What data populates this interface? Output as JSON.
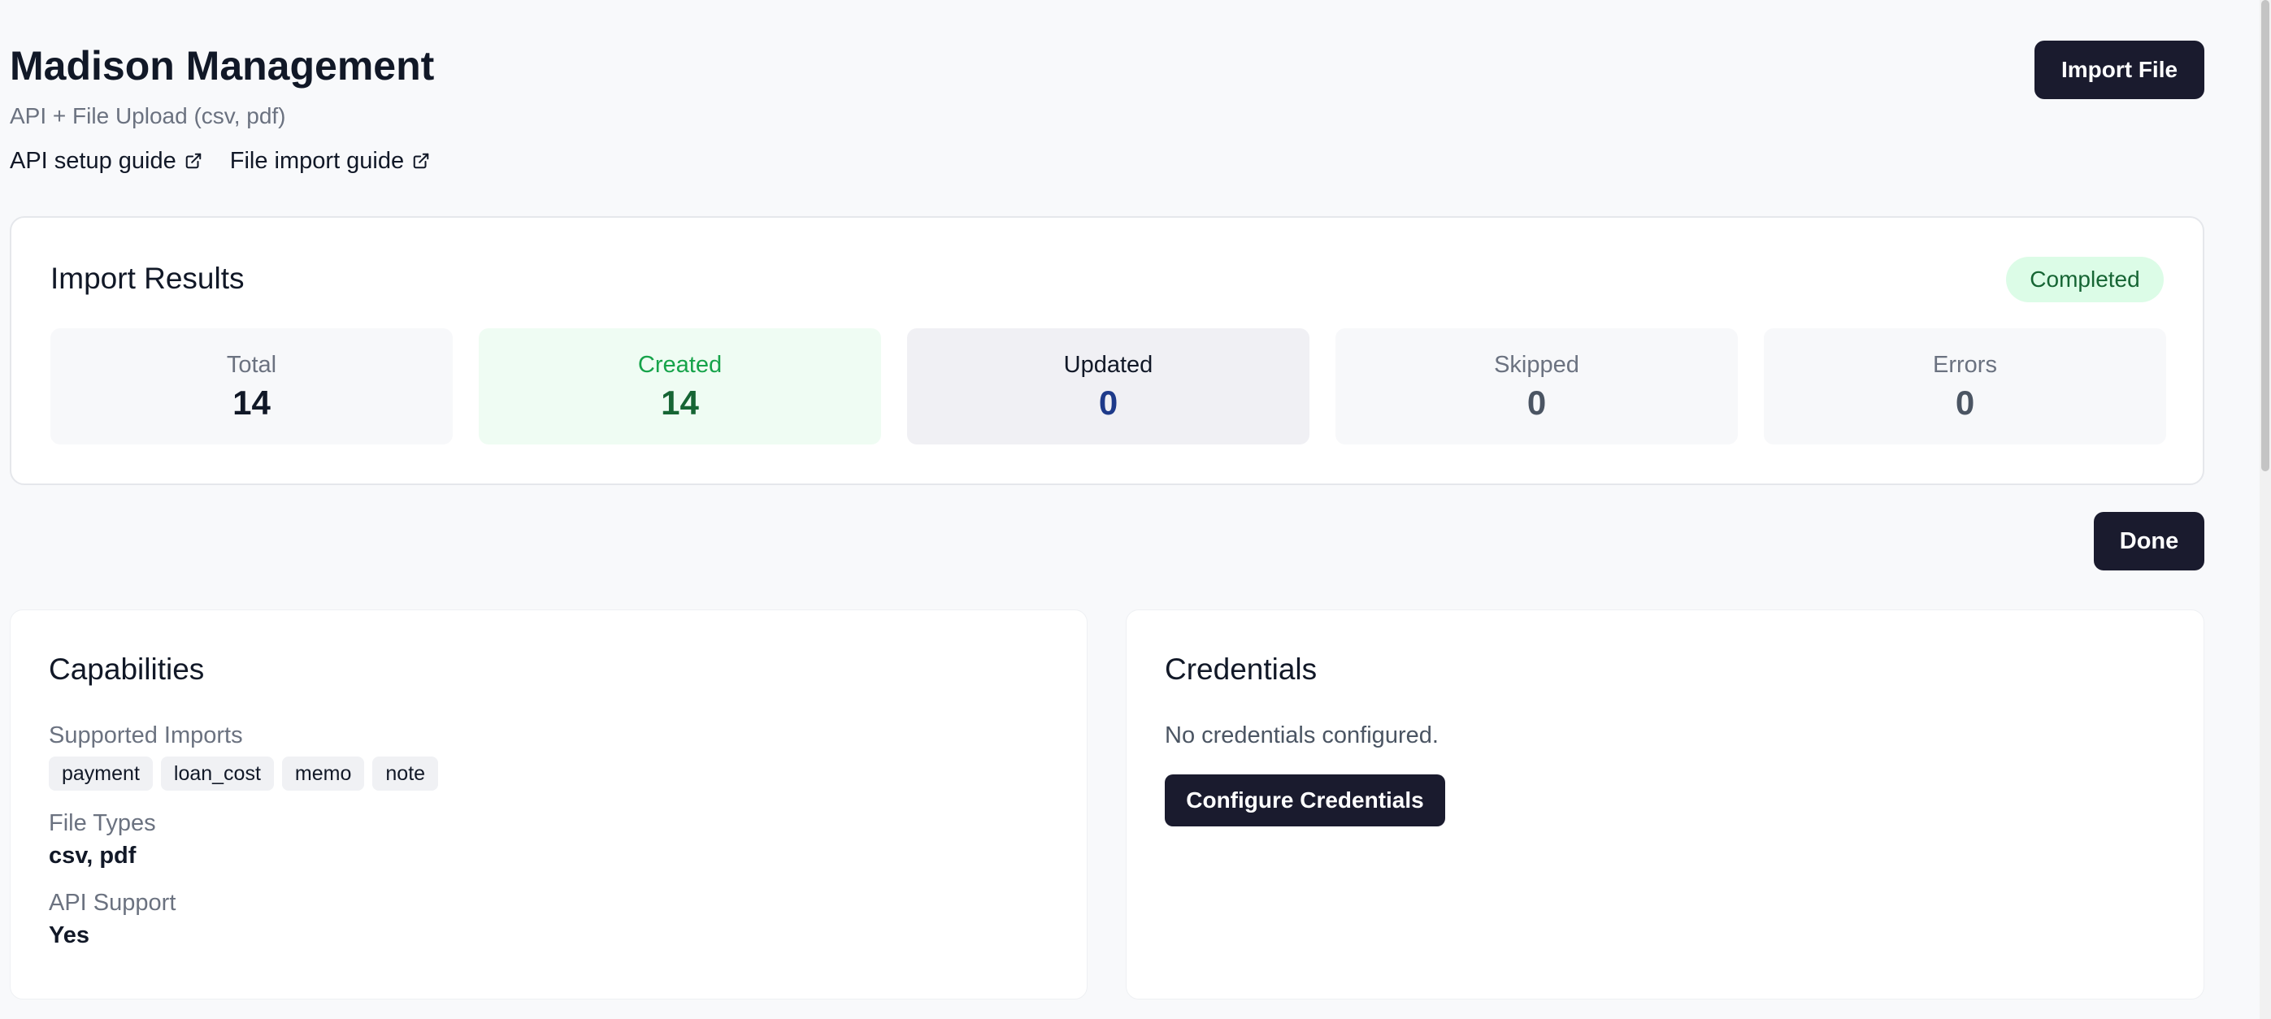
{
  "header": {
    "title": "Madison Management",
    "subtitle": "API + File Upload (csv, pdf)",
    "guides": [
      {
        "label": "API setup guide",
        "icon": "external-link-icon"
      },
      {
        "label": "File import guide",
        "icon": "external-link-icon"
      }
    ],
    "import_button": "Import File"
  },
  "results": {
    "title": "Import Results",
    "status": "Completed",
    "stats": [
      {
        "label": "Total",
        "value": "14"
      },
      {
        "label": "Created",
        "value": "14"
      },
      {
        "label": "Updated",
        "value": "0"
      },
      {
        "label": "Skipped",
        "value": "0"
      },
      {
        "label": "Errors",
        "value": "0"
      }
    ],
    "done_button": "Done"
  },
  "capabilities": {
    "title": "Capabilities",
    "supported_imports_label": "Supported Imports",
    "supported_imports": [
      "payment",
      "loan_cost",
      "memo",
      "note"
    ],
    "file_types_label": "File Types",
    "file_types": "csv, pdf",
    "api_support_label": "API Support",
    "api_support": "Yes"
  },
  "credentials": {
    "title": "Credentials",
    "empty_message": "No credentials configured.",
    "configure_button": "Configure Credentials"
  },
  "colors": {
    "primary_button": "#1a1b2e",
    "success_badge_bg": "#dcfce7",
    "success_text": "#166534",
    "updated_value": "#1e3a8a"
  }
}
